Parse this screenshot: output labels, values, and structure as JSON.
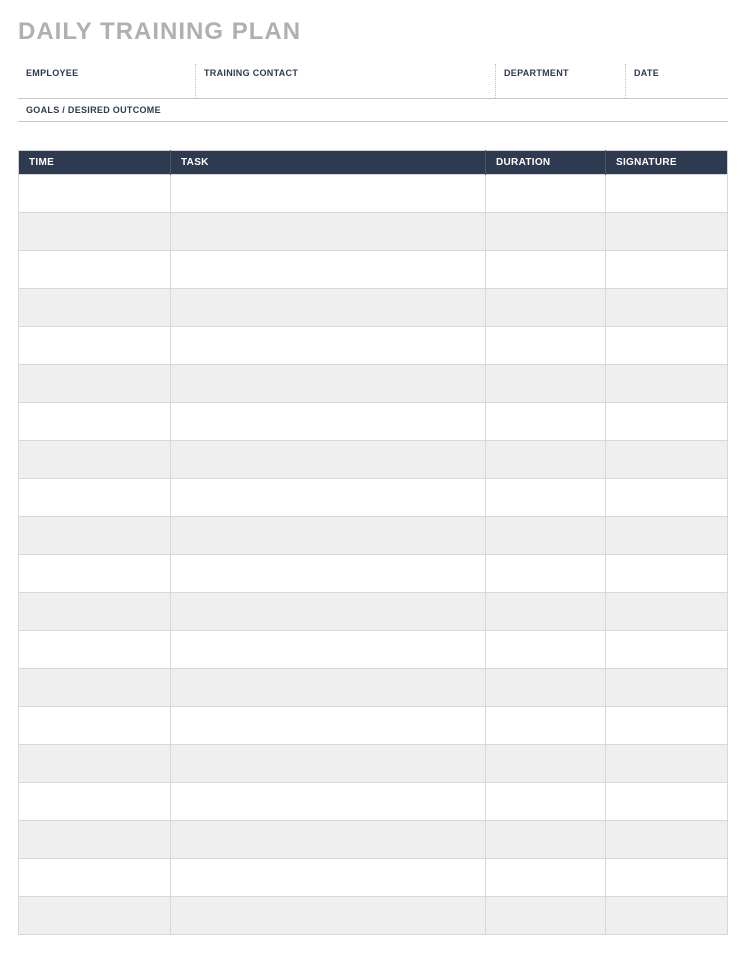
{
  "title": "DAILY TRAINING PLAN",
  "info": {
    "employee_label": "EMPLOYEE",
    "employee_value": "",
    "contact_label": "TRAINING CONTACT",
    "contact_value": "",
    "department_label": "DEPARTMENT",
    "department_value": "",
    "date_label": "DATE",
    "date_value": "",
    "goals_label": "GOALS / DESIRED OUTCOME",
    "goals_value": ""
  },
  "table": {
    "headers": {
      "time": "TIME",
      "task": "TASK",
      "duration": "DURATION",
      "signature": "SIGNATURE"
    },
    "rows": [
      {
        "time": "",
        "task": "",
        "duration": "",
        "signature": ""
      },
      {
        "time": "",
        "task": "",
        "duration": "",
        "signature": ""
      },
      {
        "time": "",
        "task": "",
        "duration": "",
        "signature": ""
      },
      {
        "time": "",
        "task": "",
        "duration": "",
        "signature": ""
      },
      {
        "time": "",
        "task": "",
        "duration": "",
        "signature": ""
      },
      {
        "time": "",
        "task": "",
        "duration": "",
        "signature": ""
      },
      {
        "time": "",
        "task": "",
        "duration": "",
        "signature": ""
      },
      {
        "time": "",
        "task": "",
        "duration": "",
        "signature": ""
      },
      {
        "time": "",
        "task": "",
        "duration": "",
        "signature": ""
      },
      {
        "time": "",
        "task": "",
        "duration": "",
        "signature": ""
      },
      {
        "time": "",
        "task": "",
        "duration": "",
        "signature": ""
      },
      {
        "time": "",
        "task": "",
        "duration": "",
        "signature": ""
      },
      {
        "time": "",
        "task": "",
        "duration": "",
        "signature": ""
      },
      {
        "time": "",
        "task": "",
        "duration": "",
        "signature": ""
      },
      {
        "time": "",
        "task": "",
        "duration": "",
        "signature": ""
      },
      {
        "time": "",
        "task": "",
        "duration": "",
        "signature": ""
      },
      {
        "time": "",
        "task": "",
        "duration": "",
        "signature": ""
      },
      {
        "time": "",
        "task": "",
        "duration": "",
        "signature": ""
      },
      {
        "time": "",
        "task": "",
        "duration": "",
        "signature": ""
      },
      {
        "time": "",
        "task": "",
        "duration": "",
        "signature": ""
      }
    ]
  }
}
